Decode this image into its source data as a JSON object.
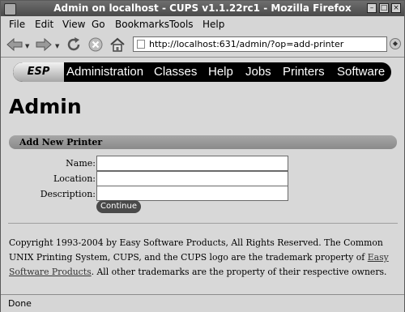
{
  "window": {
    "title": "Admin on localhost - CUPS v1.1.22rc1 - Mozilla Firefox",
    "buttons": {
      "minimize": "–",
      "maximize": "□",
      "close": "×"
    }
  },
  "menu": {
    "items": [
      "File",
      "Edit",
      "View",
      "Go",
      "Bookmarks",
      "Tools",
      "Help"
    ]
  },
  "toolbar": {
    "url": "http://localhost:631/admin/?op=add-printer",
    "go": "Go"
  },
  "nav": {
    "logo": "ESP",
    "links": [
      "Administration",
      "Classes",
      "Help",
      "Jobs",
      "Printers",
      "Software"
    ]
  },
  "page": {
    "title": "Admin"
  },
  "form": {
    "section_title": "Add New Printer",
    "fields": [
      {
        "label": "Name:",
        "value": ""
      },
      {
        "label": "Location:",
        "value": ""
      },
      {
        "label": "Description:",
        "value": ""
      }
    ],
    "submit": "Continue"
  },
  "footer": {
    "text_before": "Copyright 1993-2004 by Easy Software Products, All Rights Reserved. The Common UNIX Printing System, CUPS, and the CUPS logo are the trademark property of ",
    "link": "Easy Software Products",
    "text_after": ". All other trademarks are the property of their respective owners."
  },
  "status": {
    "text": "Done"
  }
}
